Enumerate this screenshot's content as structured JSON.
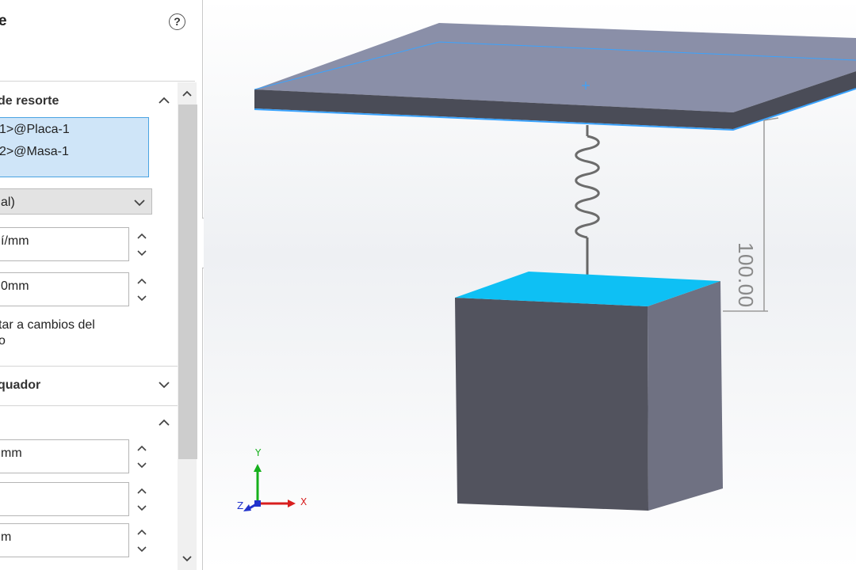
{
  "panel": {
    "title": "e",
    "help_icon": "help-icon",
    "help_glyph": "?",
    "section_spring": {
      "label": "de resorte",
      "expanded": true,
      "selections": [
        "1>@Placa-1",
        "2>@Masa-1"
      ]
    },
    "type_combo": {
      "value": "al)"
    },
    "stiffness_field": {
      "value": "í/mm"
    },
    "length_field": {
      "value": "0mm"
    },
    "update_checkbox": {
      "label_line1": "tar a cambios del",
      "label_line2": "o"
    },
    "section_damper": {
      "label": "quador",
      "expanded": false
    },
    "section_third": {
      "expanded": true
    },
    "field_a": {
      "value": "mm"
    },
    "field_b": {
      "value": ""
    },
    "field_c": {
      "value": "m"
    }
  },
  "viewport": {
    "dimension_value": "100.00",
    "triad": {
      "x_label": "X",
      "y_label": "Y",
      "z_label": "Z"
    },
    "colors": {
      "plate_top": "#8a8fa8",
      "plate_front": "#4a4c57",
      "block_front": "#52535e",
      "block_side": "#6f7182",
      "selected_face": "#0ec0f4",
      "highlight_edge": "#3aa3ff",
      "x_axis": "#d81e1e",
      "y_axis": "#16b01c",
      "z_axis": "#2233cc"
    }
  }
}
